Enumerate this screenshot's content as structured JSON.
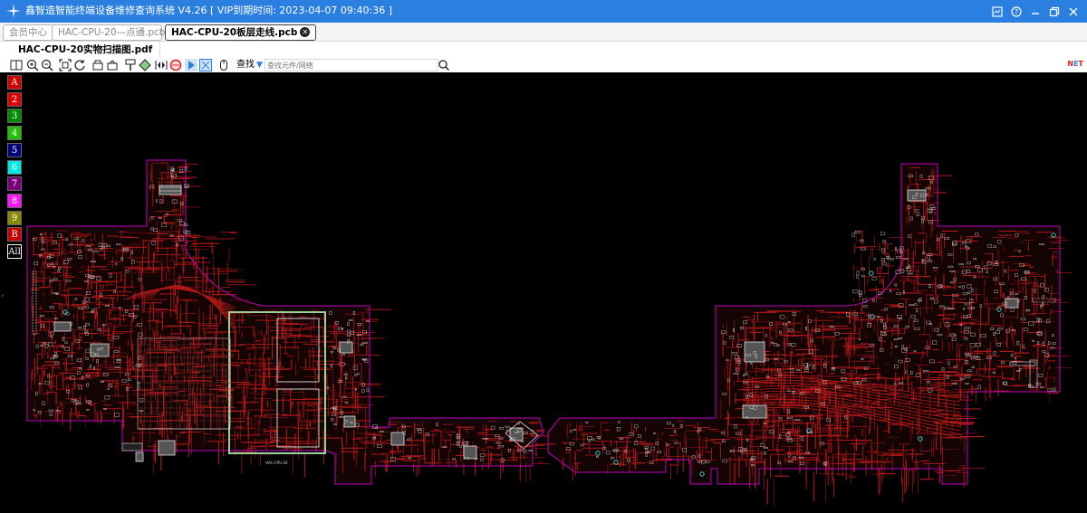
{
  "titlebar": {
    "title": "鑫智造智能终端设备维修查询系统 V4.26 [ VIP到期时间: 2023-04-07 09:40:36 ]",
    "icons": [
      "skin-icon",
      "help-icon",
      "minimize-icon",
      "restore-icon",
      "close-icon"
    ]
  },
  "tabs": [
    {
      "label": "会员中心"
    },
    {
      "label": "HAC-CPU-20—点通.pcb"
    },
    {
      "label": "HAC-CPU-20板层走线.pcb",
      "active": true
    }
  ],
  "document_tab": {
    "label": "HAC-CPU-20实物扫描图.pdf"
  },
  "toolbar": {
    "find_label": "查找",
    "search_placeholder": "查找元件/网络",
    "net_label": "NET",
    "net_colors": [
      "#e01818",
      "#2b7fe0"
    ]
  },
  "layers": [
    {
      "label": "A",
      "bg": "#d00000",
      "fg": "#ffffff"
    },
    {
      "label": "2",
      "bg": "#e00000",
      "fg": "#ffffff"
    },
    {
      "label": "3",
      "bg": "#008a00",
      "fg": "#ffffff"
    },
    {
      "label": "4",
      "bg": "#22c000",
      "fg": "#ffffff"
    },
    {
      "label": "5",
      "bg": "#00007a",
      "fg": "#ffffff"
    },
    {
      "label": "6",
      "bg": "#00e6e6",
      "fg": "#ffffff"
    },
    {
      "label": "7",
      "bg": "#7a007a",
      "fg": "#ffffff"
    },
    {
      "label": "8",
      "bg": "#ff10ff",
      "fg": "#ffffff"
    },
    {
      "label": "9",
      "bg": "#8a8a00",
      "fg": "#ffffff"
    },
    {
      "label": "B",
      "bg": "#cc0000",
      "fg": "#ffffff"
    },
    {
      "label": "All",
      "bg": "#000000",
      "fg": "#ffffff"
    }
  ],
  "board": {
    "outline_color": "#c000c0",
    "trace_color": "#b01818",
    "silk_color": "#d8d8d8",
    "shield_color": "#9ad09a",
    "pad_color": "#40c8c8",
    "label": "HAC-CPU-20"
  }
}
